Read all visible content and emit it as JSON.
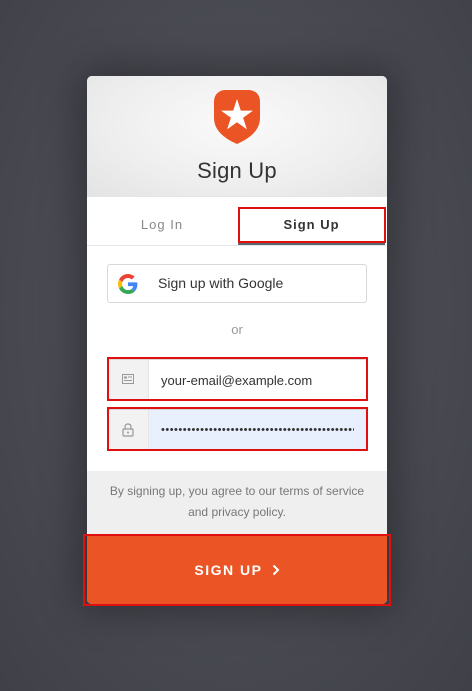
{
  "title": "Sign Up",
  "tabs": {
    "login": "Log In",
    "signup": "Sign Up"
  },
  "google": {
    "label": "Sign up with Google",
    "icon": "google-icon"
  },
  "divider": "or",
  "email": {
    "value": "your-email@example.com",
    "icon": "envelope-icon"
  },
  "password": {
    "value": "••••••••••••••••••••••••••••••••••••••••••••••",
    "icon": "lock-icon"
  },
  "terms": {
    "prefix": "By signing up, you agree to our ",
    "tos": "terms of service",
    "and": " and ",
    "privacy": "privacy policy",
    "suffix": "."
  },
  "submit": {
    "label": "SIGN UP"
  },
  "colors": {
    "brand": "#eb5424",
    "highlight": "#e01010"
  }
}
